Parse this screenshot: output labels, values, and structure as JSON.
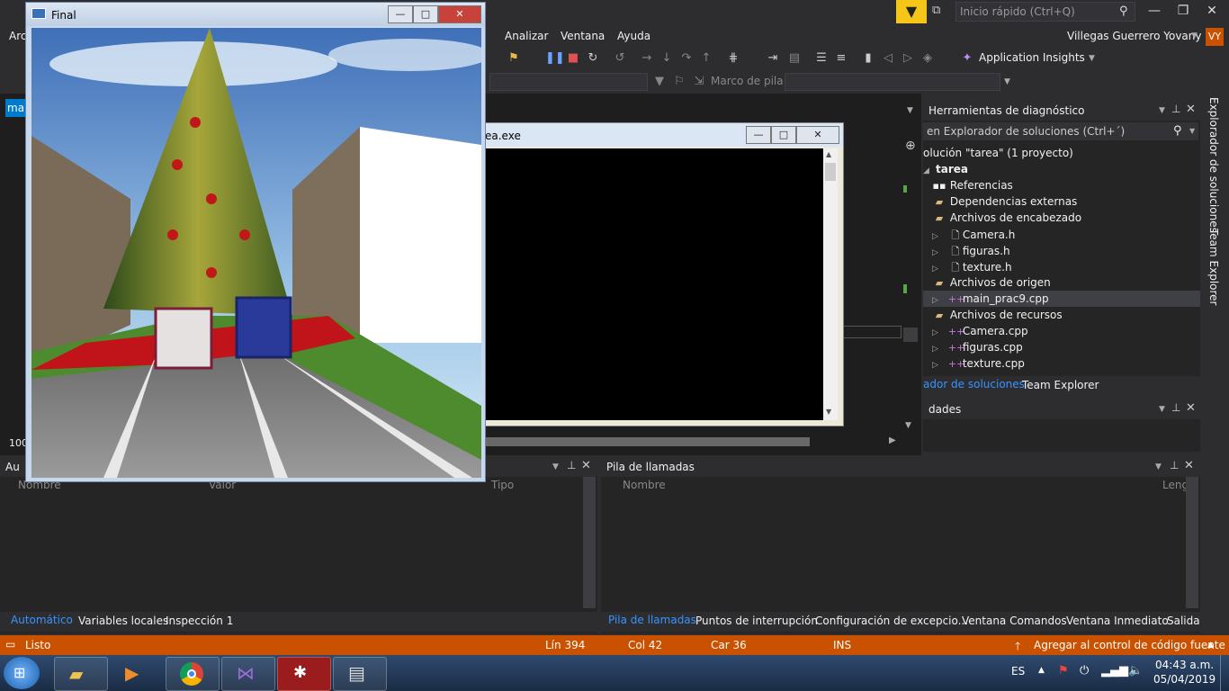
{
  "titlebar": {
    "search_placeholder": "Inicio rápido (Ctrl+Q)",
    "user_name": "Villegas Guerrero Yovany",
    "user_initials": "VY"
  },
  "menu": {
    "partial_first": "Arc",
    "items": [
      "Analizar",
      "Ventana",
      "Ayuda"
    ]
  },
  "toolbar": {
    "app_insights": "Application Insights",
    "stack_frame_label": "Marco de pila:"
  },
  "console_window": {
    "title": "ea.exe"
  },
  "final_window": {
    "title": "Final"
  },
  "solution_explorer": {
    "title": "Herramientas de diagnóstico",
    "search_placeholder": "en Explorador de soluciones (Ctrl+´)",
    "solution_label": "olución \"tarea\"  (1 proyecto)",
    "items": [
      {
        "label": "tarea",
        "icon": "project-icon"
      },
      {
        "label": "Referencias",
        "icon": "references-icon"
      },
      {
        "label": "Dependencias externas",
        "icon": "folder-icon"
      },
      {
        "label": "Archivos de encabezado",
        "icon": "folder-icon"
      },
      {
        "label": "Camera.h",
        "icon": "header-file-icon"
      },
      {
        "label": "figuras.h",
        "icon": "header-file-icon"
      },
      {
        "label": "texture.h",
        "icon": "header-file-icon"
      },
      {
        "label": "Archivos de origen",
        "icon": "folder-icon"
      },
      {
        "label": "main_prac9.cpp",
        "icon": "cpp-file-icon"
      },
      {
        "label": "Archivos de recursos",
        "icon": "folder-icon"
      },
      {
        "label": "Camera.cpp",
        "icon": "cpp-file-icon"
      },
      {
        "label": "figuras.cpp",
        "icon": "cpp-file-icon"
      },
      {
        "label": "texture.cpp",
        "icon": "cpp-file-icon"
      }
    ],
    "tabs": [
      "ador de soluciones",
      "Team Explorer"
    ]
  },
  "properties_pane": {
    "title": "dades"
  },
  "side_strip": {
    "labels": [
      "Explorador de soluciones",
      "Team Explorer"
    ]
  },
  "editor": {
    "zoom": "100",
    "tab_partial": "ma"
  },
  "auto_pane": {
    "title": "Au",
    "columns": [
      "Nombre",
      "Valor",
      "Tipo"
    ],
    "tabs": [
      "Automático",
      "Variables locales",
      "Inspección 1"
    ]
  },
  "call_stack_pane": {
    "title": "Pila de llamadas",
    "columns": [
      "Nombre",
      "Leng"
    ],
    "tabs": [
      "Pila de llamadas",
      "Puntos de interrupción",
      "Configuración de excepcio...",
      "Ventana Comandos",
      "Ventana Inmediato",
      "Salida"
    ]
  },
  "statusbar": {
    "status": "Listo",
    "line": "Lín 394",
    "col": "Col 42",
    "char": "Car 36",
    "mode": "INS",
    "source_control": "Agregar al control de código fuente"
  },
  "taskbar": {
    "language": "ES",
    "time": "04:43 a.m.",
    "date": "05/04/2019"
  },
  "colors": {
    "accent": "#ca5100",
    "notification": "#f5c518",
    "active_tab": "#3794ff"
  }
}
